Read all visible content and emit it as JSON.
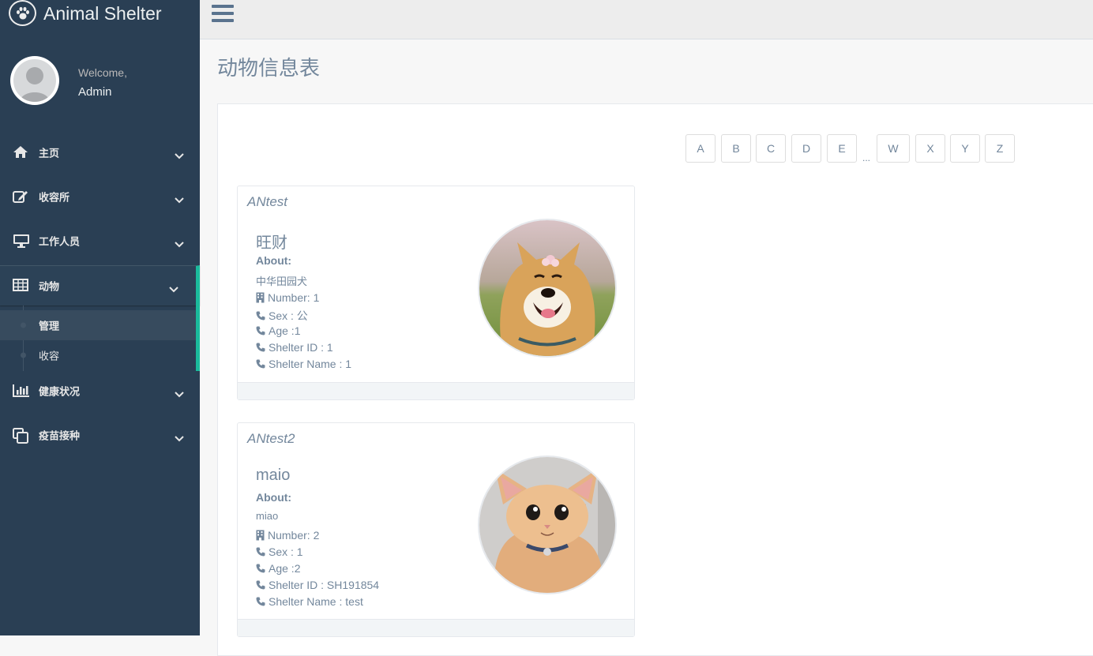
{
  "brand": {
    "title": "Animal Shelter",
    "icon": "paw-icon"
  },
  "profile": {
    "welcome": "Welcome,",
    "name": "Admin"
  },
  "sidebar": {
    "items": [
      {
        "label": "主页",
        "icon": "home-icon"
      },
      {
        "label": "收容所",
        "icon": "edit-icon"
      },
      {
        "label": "工作人员",
        "icon": "desktop-icon"
      },
      {
        "label": "动物",
        "icon": "table-icon"
      },
      {
        "label": "健康状况",
        "icon": "bar-chart-icon"
      },
      {
        "label": "疫苗接种",
        "icon": "clone-icon"
      }
    ],
    "children": [
      {
        "label": "管理"
      },
      {
        "label": "收容"
      }
    ]
  },
  "page": {
    "title": "动物信息表"
  },
  "pagination": {
    "letters": [
      "A",
      "B",
      "C",
      "D",
      "E",
      "W",
      "X",
      "Y",
      "Z"
    ],
    "ellipsis": "..."
  },
  "cards": [
    {
      "brief": "ANtest",
      "name": "旺财",
      "about_label": "About:",
      "about": "中华田园犬",
      "number": "Number: 1",
      "sex": "Sex : 公",
      "age": "Age :1",
      "shelter_id": "Shelter ID : 1",
      "shelter_name": "Shelter Name : 1",
      "photo": "shiba-dog-photo"
    },
    {
      "brief": "ANtest2",
      "name": "maio",
      "about_label": "About:",
      "about": "miao",
      "number": "Number: 2",
      "sex": "Sex : 1",
      "age": "Age :2",
      "shelter_id": "Shelter ID : SH191854",
      "shelter_name": "Shelter Name : test",
      "photo": "orange-kitten-photo"
    }
  ],
  "colors": {
    "sidebar": "#2A3F54",
    "accent": "#1ABB9C",
    "text": "#73879C",
    "topbar": "#EDEDED"
  }
}
